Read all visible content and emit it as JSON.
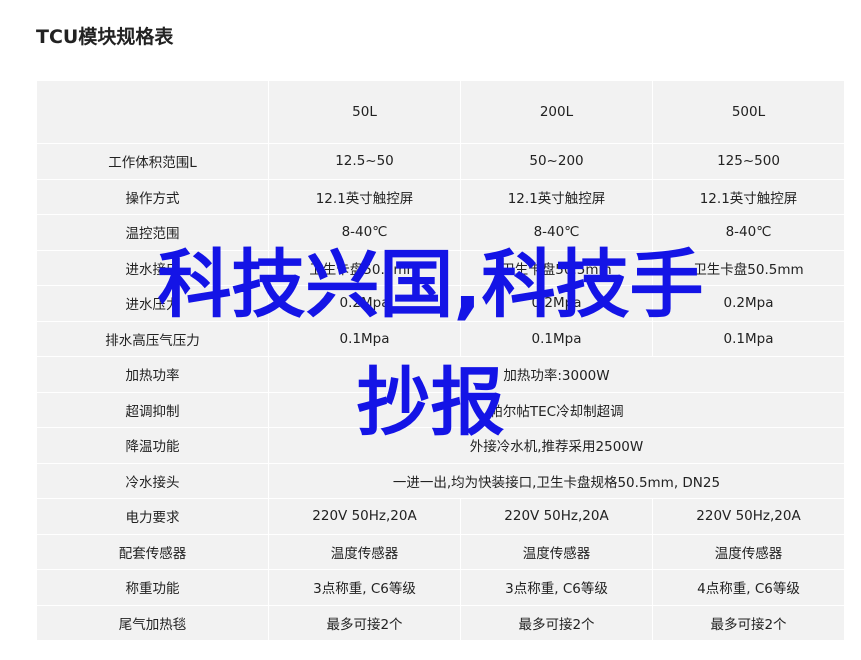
{
  "title": "TCU模块规格表",
  "overlay": {
    "line1": "科技兴国,科技手",
    "line2": "抄报",
    "color": "#1414e6"
  },
  "table": {
    "columns": [
      "",
      "50L",
      "200L",
      "500L"
    ],
    "rows": [
      {
        "label": "工作体积范围L",
        "values": [
          "12.5~50",
          "50~200",
          "125~500"
        ]
      },
      {
        "label": "操作方式",
        "values": [
          "12.1英寸触控屏",
          "12.1英寸触控屏",
          "12.1英寸触控屏"
        ]
      },
      {
        "label": "温控范围",
        "values": [
          "8-40℃",
          "8-40℃",
          "8-40℃"
        ]
      },
      {
        "label": "进水接口",
        "values": [
          "卫生卡盘50.5mm",
          "卫生卡盘50.5mm",
          "卫生卡盘50.5mm"
        ]
      },
      {
        "label": "进水压力",
        "values": [
          "0.2Mpa",
          "0.2Mpa",
          "0.2Mpa"
        ]
      },
      {
        "label": "排水高压气压力",
        "values": [
          "0.1Mpa",
          "0.1Mpa",
          "0.1Mpa"
        ]
      },
      {
        "label": "加热功率",
        "merged": "加热功率:3000W"
      },
      {
        "label": "超调抑制",
        "merged": "帕尔帖TEC冷却制超调"
      },
      {
        "label": "降温功能",
        "merged": "外接冷水机,推荐采用2500W"
      },
      {
        "label": "冷水接头",
        "merged": "一进一出,均为快装接口,卫生卡盘规格50.5mm, DN25"
      },
      {
        "label": "电力要求",
        "values": [
          "220V 50Hz,20A",
          "220V 50Hz,20A",
          "220V 50Hz,20A"
        ]
      },
      {
        "label": "配套传感器",
        "values": [
          "温度传感器",
          "温度传感器",
          "温度传感器"
        ]
      },
      {
        "label": "称重功能",
        "values": [
          "3点称重, C6等级",
          "3点称重, C6等级",
          "4点称重, C6等级"
        ]
      },
      {
        "label": "尾气加热毯",
        "values": [
          "最多可接2个",
          "最多可接2个",
          "最多可接2个"
        ]
      }
    ]
  }
}
